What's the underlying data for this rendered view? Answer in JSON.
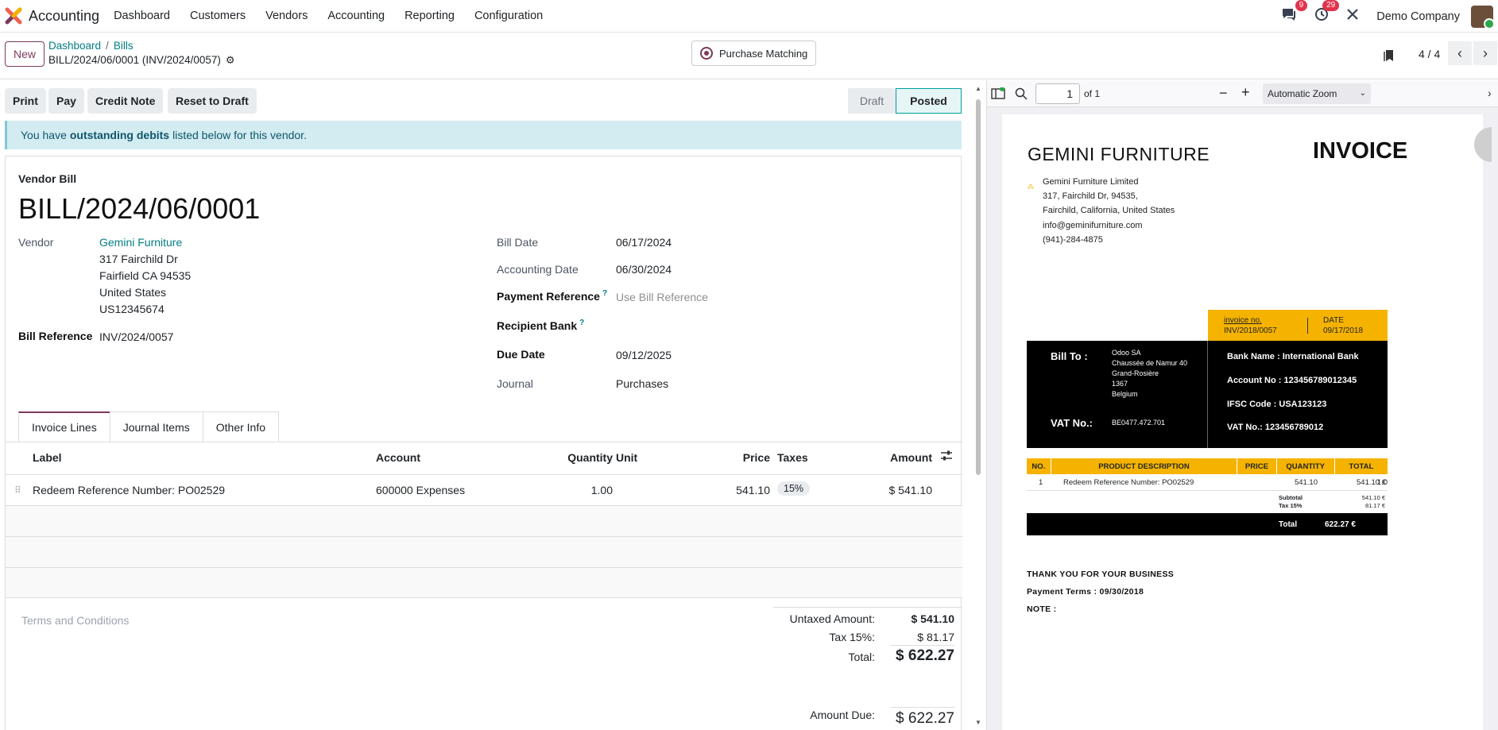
{
  "topnav": {
    "app_title": "Accounting",
    "menu": [
      "Dashboard",
      "Customers",
      "Vendors",
      "Accounting",
      "Reporting",
      "Configuration"
    ],
    "messages_badge": "9",
    "activities_badge": "29",
    "company": "Demo Company"
  },
  "control": {
    "new_label": "New",
    "breadcrumb": [
      "Dashboard",
      "Bills"
    ],
    "record_name": "BILL/2024/06/0001 (INV/2024/0057)",
    "purchase_matching": "Purchase Matching",
    "pager": "4 / 4"
  },
  "actions": {
    "print": "Print",
    "pay": "Pay",
    "credit_note": "Credit Note",
    "reset_to_draft": "Reset to Draft",
    "stage_draft": "Draft",
    "stage_posted": "Posted"
  },
  "alert": {
    "prefix": "You have",
    "bold": "outstanding debits",
    "suffix": "listed below for this vendor."
  },
  "form": {
    "type_label": "Vendor Bill",
    "title": "BILL/2024/06/0001",
    "vendor_label": "Vendor",
    "vendor_name": "Gemini Furniture",
    "vendor_address": [
      "317 Fairchild Dr",
      "Fairfield CA 94535",
      "United States",
      "US12345674"
    ],
    "bill_reference_label": "Bill Reference",
    "bill_reference": "INV/2024/0057",
    "bill_date_label": "Bill Date",
    "bill_date": "06/17/2024",
    "accounting_date_label": "Accounting Date",
    "accounting_date": "06/30/2024",
    "payment_reference_label": "Payment Reference",
    "payment_reference_placeholder": "Use Bill Reference",
    "recipient_bank_label": "Recipient Bank",
    "due_date_label": "Due Date",
    "due_date": "09/12/2025",
    "journal_label": "Journal",
    "journal": "Purchases"
  },
  "tabs": [
    "Invoice Lines",
    "Journal Items",
    "Other Info"
  ],
  "lines": {
    "headers": {
      "label": "Label",
      "account": "Account",
      "quantity": "Quantity",
      "unit": "Unit",
      "price": "Price",
      "taxes": "Taxes",
      "amount": "Amount"
    },
    "rows": [
      {
        "label": "Redeem Reference Number: PO02529",
        "account": "600000 Expenses",
        "quantity": "1.00",
        "unit": "",
        "price": "541.10",
        "taxes": "15%",
        "amount": "$ 541.10"
      }
    ]
  },
  "terms_placeholder": "Terms and Conditions",
  "totals": {
    "untaxed_label": "Untaxed Amount:",
    "untaxed": "$ 541.10",
    "tax_label": "Tax 15%:",
    "tax": "$ 81.17",
    "total_label": "Total:",
    "total": "$ 622.27",
    "amount_due_label": "Amount Due:",
    "amount_due": "$ 622.27"
  },
  "pdf": {
    "page": "1",
    "of": "of 1",
    "zoom": "Automatic Zoom",
    "doc": {
      "company": "GEMINI FURNITURE",
      "title": "INVOICE",
      "address": [
        "Gemini Furniture Limited",
        "317, Fairchild Dr, 94535,",
        "Fairchild, California, United States",
        "info@geminifurniture.com",
        "(941)-284-4875"
      ],
      "invoice_no_label": "invoice no.",
      "invoice_no": "INV/2018/0057",
      "date_label": "DATE",
      "date": "09/17/2018",
      "bill_to_label": "Bill To :",
      "bill_to": [
        "Odoo SA",
        "Chaussée de Namur 40",
        "Grand-Rosière",
        "1367",
        "Belgium"
      ],
      "vat_label": "VAT No.:",
      "vat": "BE0477.472.701",
      "bank_name": "Bank Name : International Bank",
      "account_no": "Account No : 123456789012345",
      "ifsc": "IFSC Code : USA123123",
      "vat_no": "VAT No.: 123456789012",
      "table_headers": [
        "NO.",
        "PRODUCT DESCRIPTION",
        "PRICE",
        "QUANTITY",
        "TOTAL"
      ],
      "row": [
        "1",
        "Redeem Reference Number: PO02529",
        "541.10",
        "1.0",
        "541.10 €"
      ],
      "subtotal_label": "Subtotal",
      "subtotal": "541.10 €",
      "tax_label": "Tax 15%",
      "tax": "81.17 €",
      "total_label": "Total",
      "total": "622.27 €",
      "thanks": "THANK YOU FOR YOUR BUSINESS",
      "payment_terms": "Payment Terms : 09/30/2018",
      "note": "NOTE :"
    }
  }
}
